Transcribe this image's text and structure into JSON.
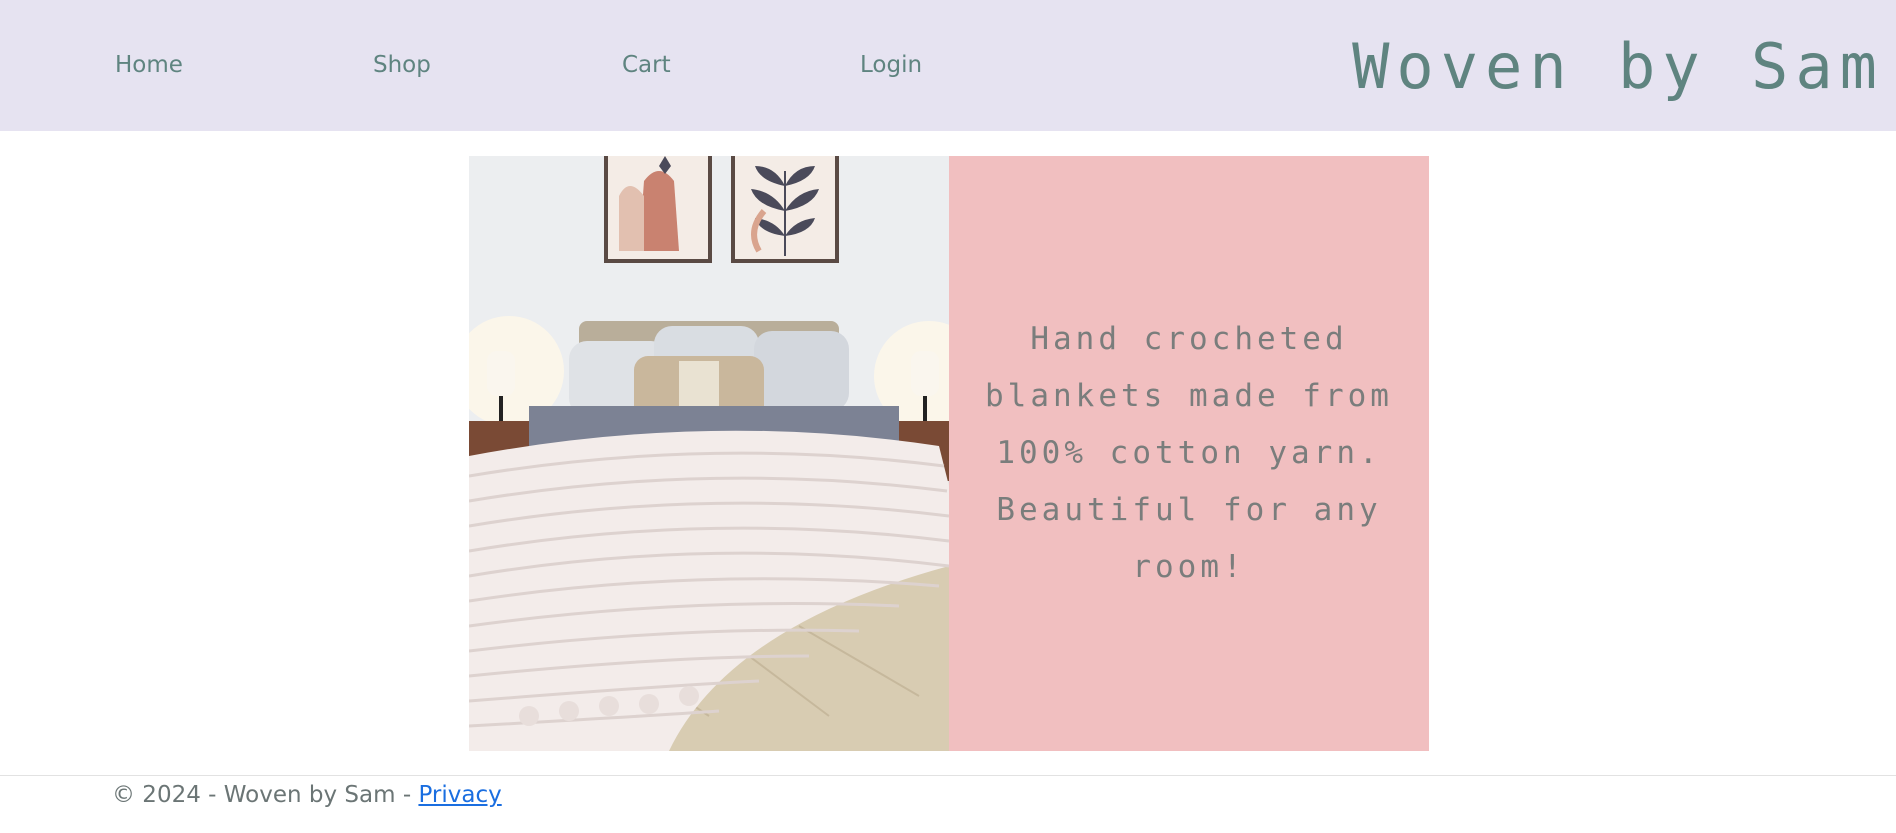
{
  "nav": {
    "items": [
      {
        "label": "Home"
      },
      {
        "label": "Shop"
      },
      {
        "label": "Cart"
      },
      {
        "label": "Login"
      }
    ],
    "brand": "Woven by Sam"
  },
  "hero": {
    "image_subject": "bedroom-with-chunky-knit-blanket",
    "tagline": "Hand crocheted blankets made from 100% cotton yarn. Beautiful for any room!"
  },
  "footer": {
    "copyright": "© 2024 - Woven by Sam - ",
    "privacy_label": "Privacy"
  },
  "colors": {
    "header_bg": "#e6e3f1",
    "nav_text": "#5f8480",
    "panel_bg": "#f1bfc0",
    "tagline_text": "#7a7d7c",
    "link": "#1a6ee0"
  }
}
